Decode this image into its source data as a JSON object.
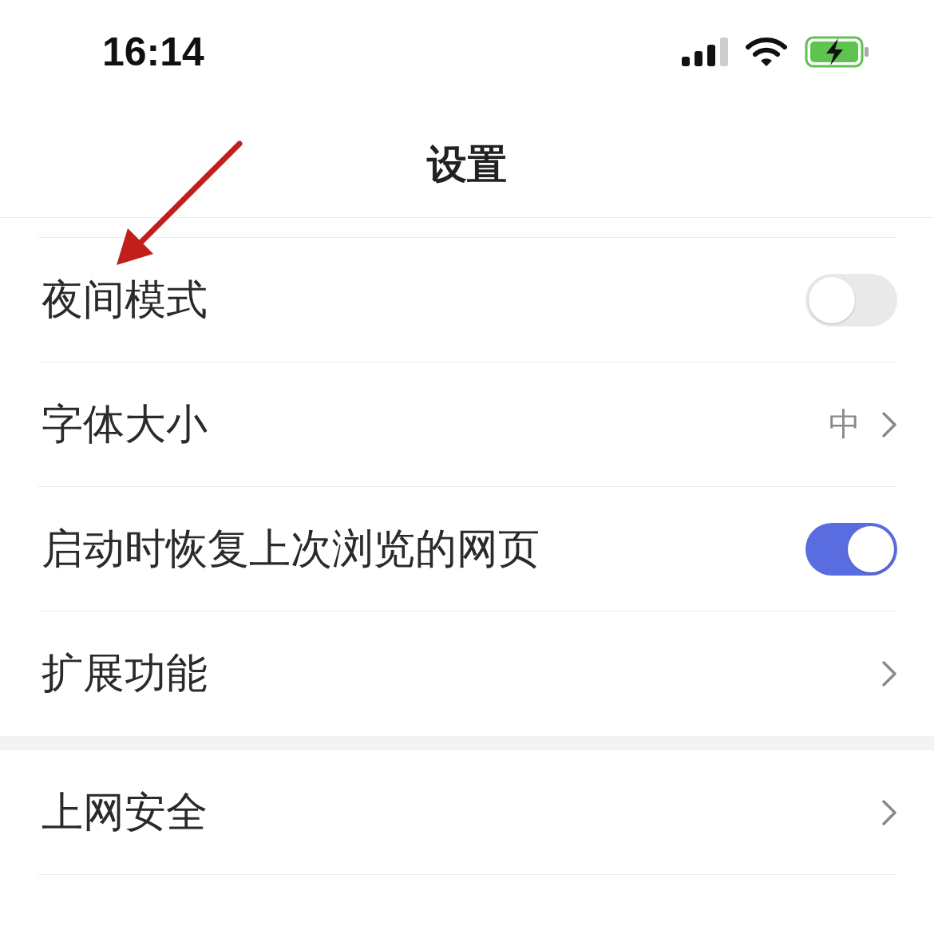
{
  "status_bar": {
    "time": "16:14"
  },
  "title": "设置",
  "sections": [
    {
      "rows": [
        {
          "kind": "toggle",
          "label": "夜间模式",
          "on": false
        },
        {
          "kind": "link",
          "label": "字体大小",
          "value": "中"
        },
        {
          "kind": "toggle",
          "label": "启动时恢复上次浏览的网页",
          "on": true
        },
        {
          "kind": "link",
          "label": "扩展功能"
        }
      ]
    },
    {
      "rows": [
        {
          "kind": "link",
          "label": "上网安全"
        }
      ]
    }
  ]
}
